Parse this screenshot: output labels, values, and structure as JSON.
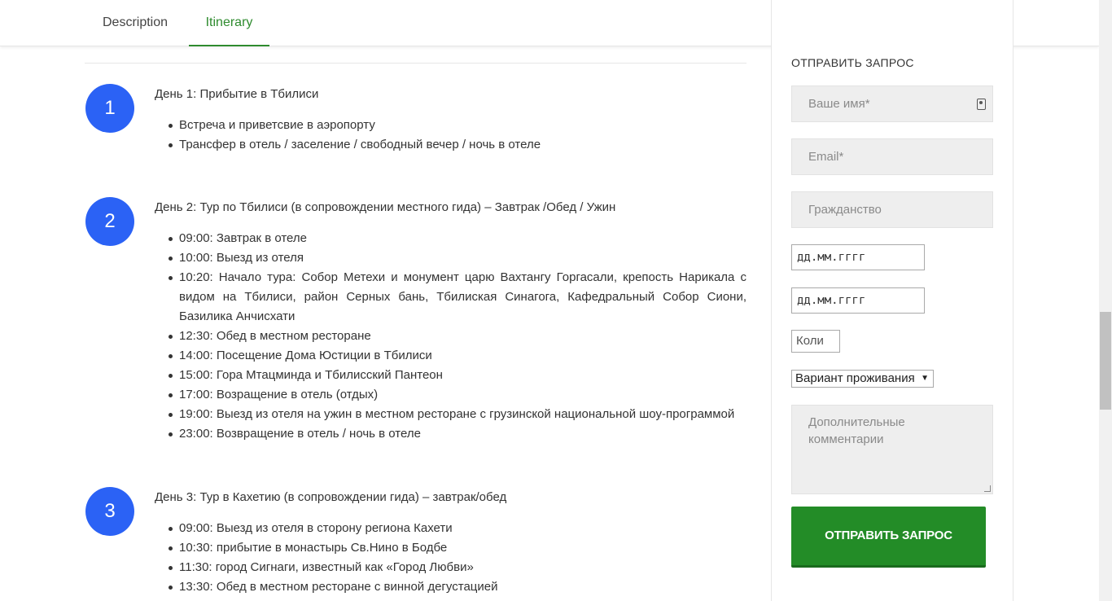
{
  "tabs": [
    {
      "label": "Description"
    },
    {
      "label": "Itinerary"
    }
  ],
  "days": [
    {
      "num": "1",
      "title": "День 1: Прибытие в Тбилиси",
      "items": [
        "Встреча и приветсвие в аэропорту",
        "Трансфер в отель / заселение / свободный вечер / ночь в отеле"
      ]
    },
    {
      "num": "2",
      "title": "День 2: Тур по Тбилиси (в сопровождении местного гида) – Завтрак /Обед / Ужин",
      "items": [
        "09:00: Завтрак в отеле",
        "10:00: Выезд из отеля",
        "10:20: Начало тура: Собор Метехи и монумент царю Вахтангу Горгасали, крепость Нарикала с видом на Тбилиси, район Серных бань, Тбилиская Синагога, Кафедральный Собор Сиони, Базилика Анчисхати",
        "12:30: Обед в местном ресторане",
        "14:00: Посещение Дома Юстиции в Тбилиси",
        "15:00: Гора Мтацминда и Тбилисский Пантеон",
        "17:00: Возращение в отель (отдых)",
        "19:00: Выезд из отеля на ужин в местном ресторане с грузинской национальной шоу-программой",
        "23:00: Возвращение в отель / ночь в отеле"
      ]
    },
    {
      "num": "3",
      "title": "День 3: Тур в Кахетию (в сопровождении гида) – завтрак/обед",
      "items": [
        "09:00: Выезд из отеля в сторону региона Кахети",
        "10:30: прибытие в монастырь Св.Нино в Бодбе",
        "11:30: город Сигнаги, известный как «Город Любви»",
        "13:30: Обед в местном ресторане с винной дегустацией"
      ]
    }
  ],
  "form": {
    "title": "ОТПРАВИТЬ ЗАПРОС",
    "name_placeholder": "Ваше имя*",
    "email_placeholder": "Email*",
    "citizenship_placeholder": "Гражданство",
    "date_from_placeholder": "дд.мм.гггг",
    "date_to_placeholder": "дд.мм.гггг",
    "count_placeholder": "Коли",
    "accommodation_selected": "Вариант проживания",
    "comments_placeholder": "Дополнительные комментарии",
    "submit_label": "ОТПРАВИТЬ ЗАПРОС",
    "icon_name": "contact-card-icon",
    "accent_color": "#238c27"
  }
}
